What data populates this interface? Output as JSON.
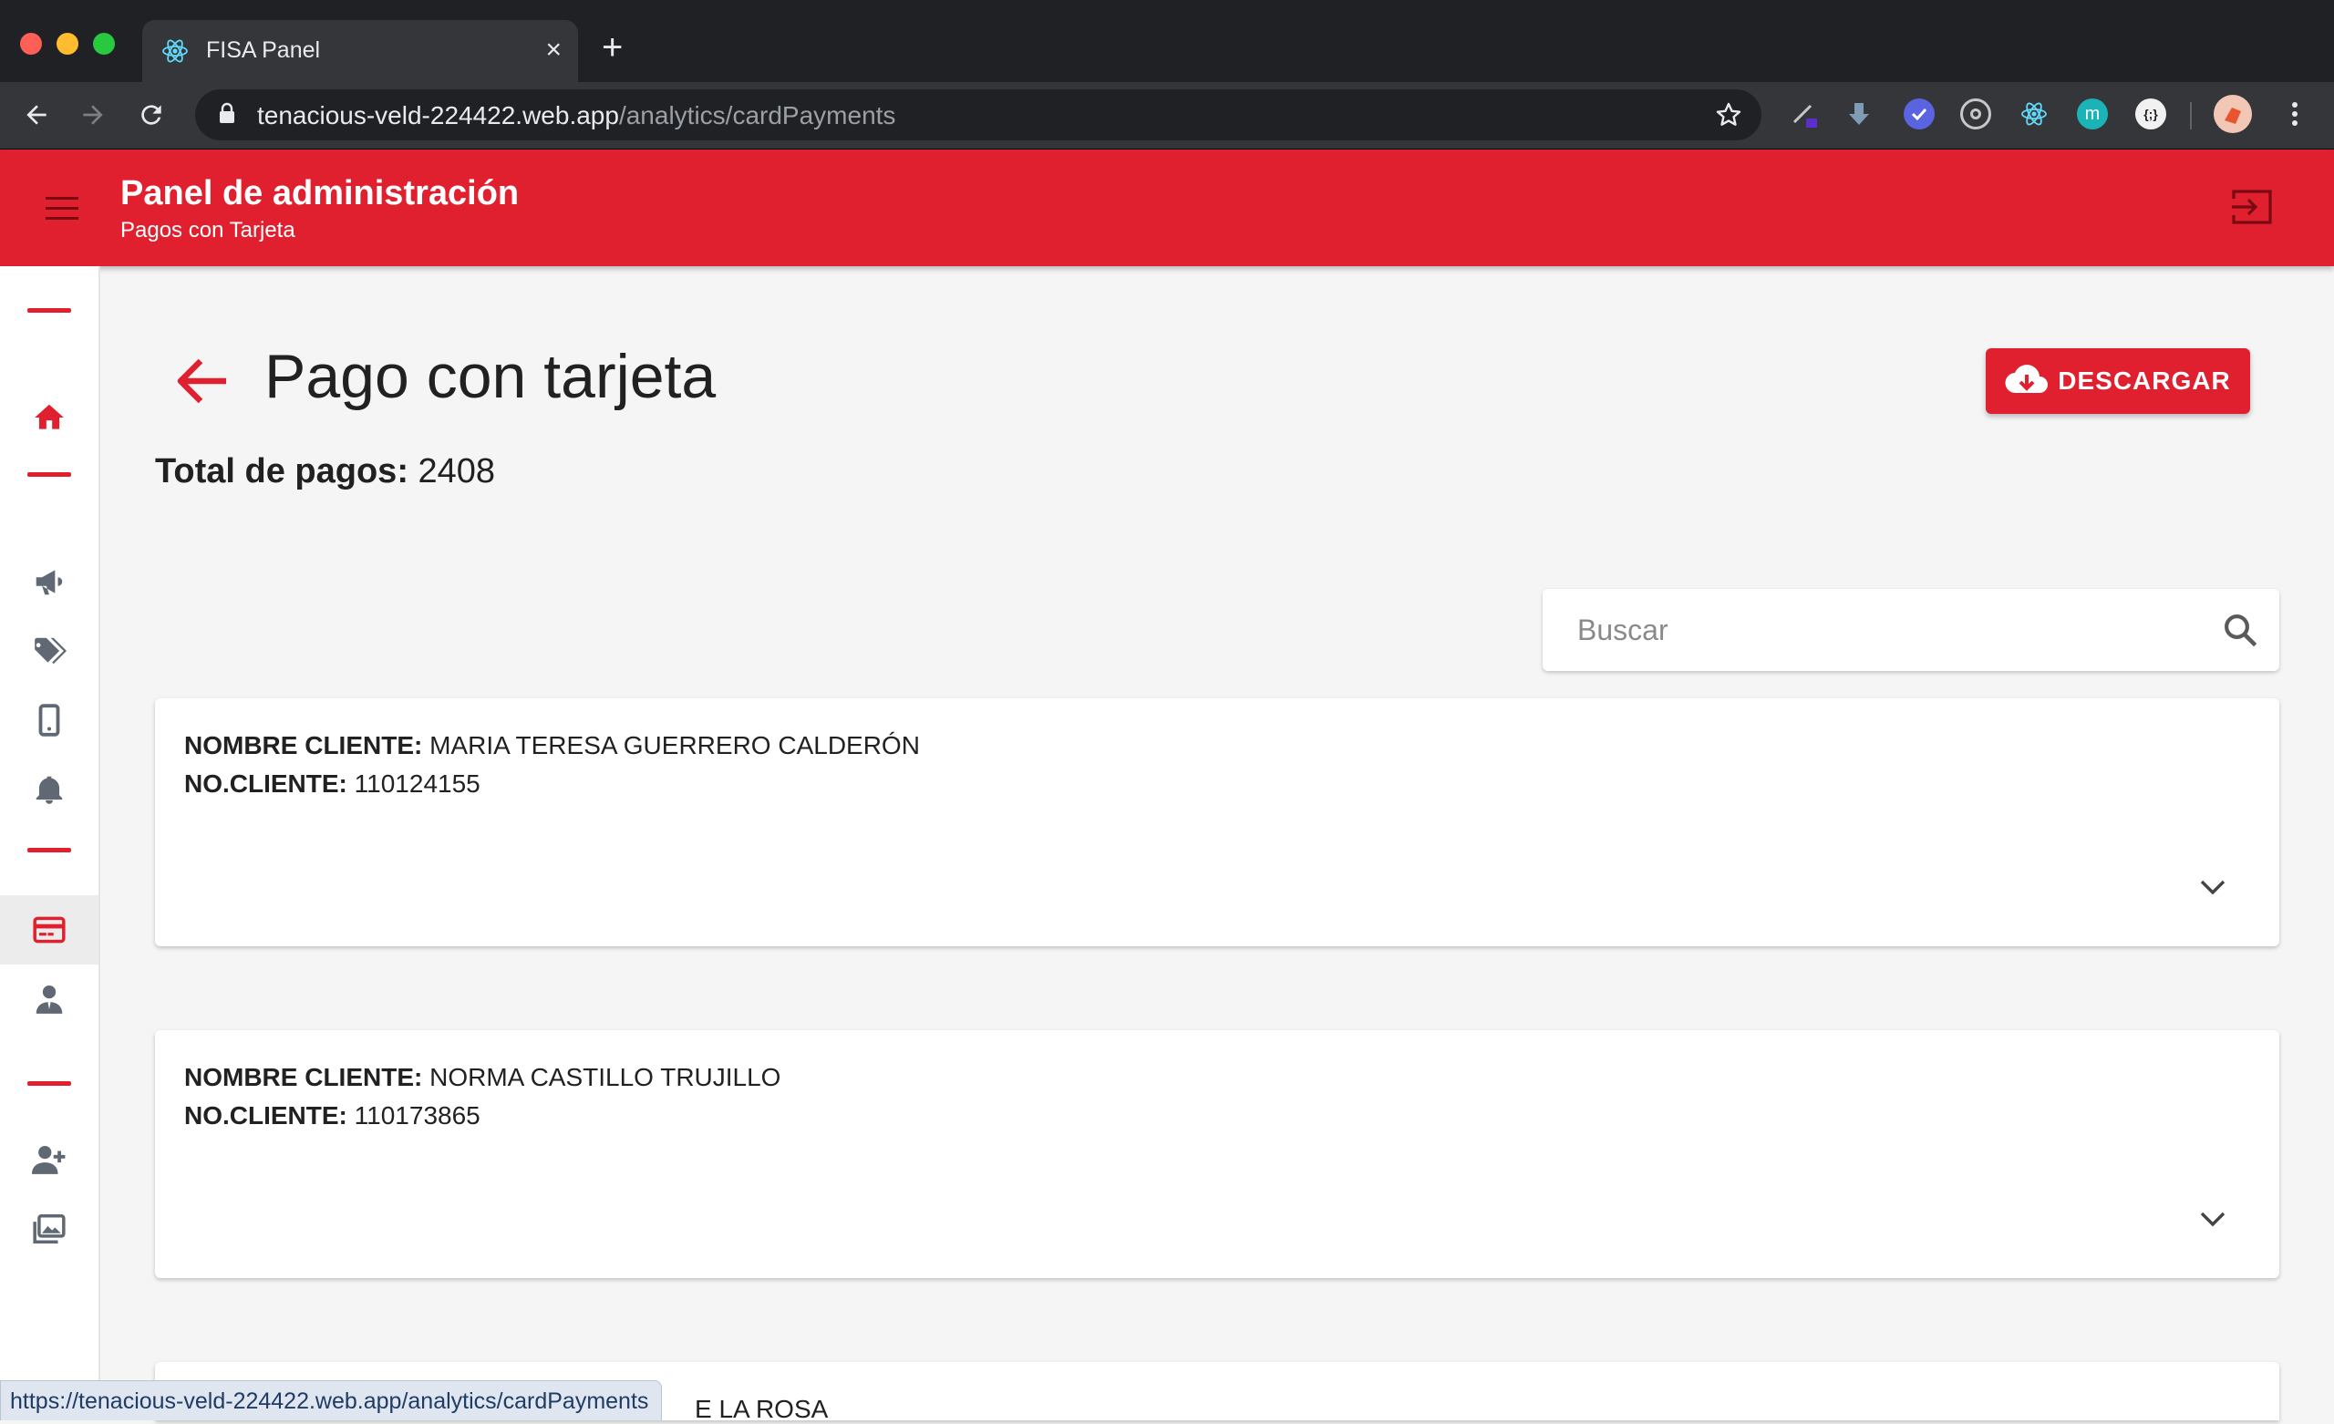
{
  "browser": {
    "tab_title": "FISA Panel",
    "new_tab_label": "+",
    "close_tab_label": "×",
    "url_host": "tenacious-veld-224422.web.app",
    "url_path": "/analytics/cardPayments",
    "status_url": "https://tenacious-veld-224422.web.app/analytics/cardPayments",
    "extension_m_label": "m",
    "extension_braces_label": "{;}"
  },
  "appbar": {
    "title": "Panel de administración",
    "subtitle": "Pagos con Tarjeta"
  },
  "page": {
    "title": "Pago con tarjeta",
    "total_label": "Total de pagos:",
    "total_value": "2408",
    "download_label": "DESCARGAR",
    "search_placeholder": "Buscar"
  },
  "payments": [
    {
      "name_label": "NOMBRE CLIENTE:",
      "name": "MARIA TERESA GUERRERO CALDERÓN",
      "number_label": "NO.CLIENTE:",
      "number": "110124155"
    },
    {
      "name_label": "NOMBRE CLIENTE:",
      "name": "NORMA CASTILLO TRUJILLO",
      "number_label": "NO.CLIENTE:",
      "number": "110173865"
    },
    {
      "partial_name": "E LA ROSA"
    }
  ],
  "colors": {
    "brand_red": "#e0202f",
    "chrome_dark": "#202124",
    "chrome_toolbar": "#35363a"
  }
}
